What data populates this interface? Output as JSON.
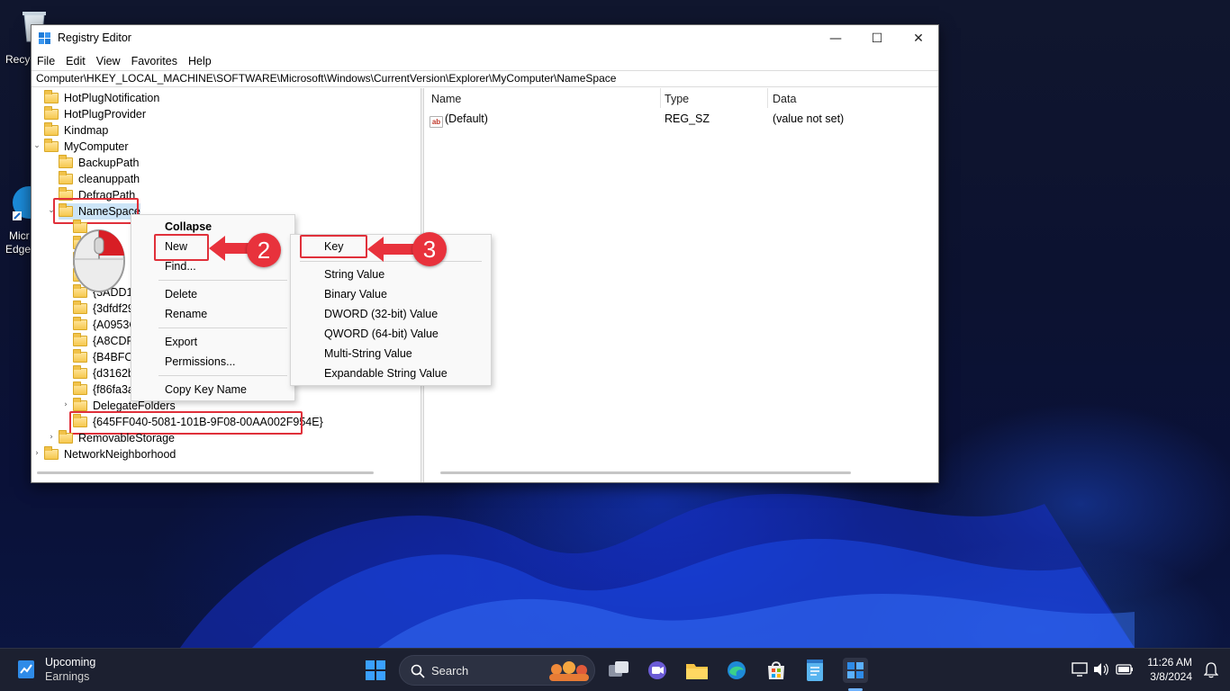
{
  "desktop": {
    "icons": [
      {
        "label": "Recyc"
      },
      {
        "label": "Micr"
      },
      {
        "label": "Edge"
      }
    ]
  },
  "window": {
    "title": "Registry Editor",
    "controls": {
      "minimize": "—",
      "maximize": "☐",
      "close": "✕"
    },
    "menu": [
      "File",
      "Edit",
      "View",
      "Favorites",
      "Help"
    ],
    "address": "Computer\\HKEY_LOCAL_MACHINE\\SOFTWARE\\Microsoft\\Windows\\CurrentVersion\\Explorer\\MyComputer\\NameSpace",
    "tree": {
      "hotplug_notification": "HotPlugNotification",
      "hotplug_provider": "HotPlugProvider",
      "kindmap": "Kindmap",
      "mycomputer": "MyComputer",
      "backuppath": "BackupPath",
      "cleanuppath": "cleanuppath",
      "defragpath": "DefragPath",
      "namespace": "NameSpace",
      "children": [
        "{3ADD16",
        "{3dfdf29",
        "{A0953C",
        "{A8CDFF",
        "{B4BFCC",
        "{d3162b",
        "{f86fa3a"
      ],
      "delegate_folders": "DelegateFolders",
      "new_key": "{645FF040-5081-101B-9F08-00AA002F954E}",
      "removable_storage": "RemovableStorage",
      "network_neighborhood": "NetworkNeighborhood"
    },
    "list": {
      "columns": {
        "name": "Name",
        "type": "Type",
        "data": "Data"
      },
      "rows": [
        {
          "name": "(Default)",
          "type": "REG_SZ",
          "data": "(value not set)",
          "icon": "ab"
        }
      ]
    }
  },
  "context_menu": {
    "collapse": "Collapse",
    "new": "New",
    "find": "Find...",
    "delete": "Delete",
    "rename": "Rename",
    "export": "Export",
    "permissions": "Permissions...",
    "copy_key_name": "Copy Key Name"
  },
  "submenu": {
    "key": "Key",
    "string_value": "String Value",
    "binary_value": "Binary Value",
    "dword_value": "DWORD (32-bit) Value",
    "qword_value": "QWORD (64-bit) Value",
    "multi_string_value": "Multi-String Value",
    "expandable_string_value": "Expandable String Value"
  },
  "annotations": {
    "step2": "2",
    "step3": "3",
    "accent": "#e8323c"
  },
  "taskbar": {
    "widget_title": "Upcoming",
    "widget_subtitle": "Earnings",
    "search_placeholder": "Search",
    "time": "11:26 AM",
    "date": "3/8/2024",
    "pinned": [
      "start-icon",
      "search-icon",
      "task-view-icon",
      "teams-icon",
      "file-explorer-icon",
      "edge-icon",
      "store-icon",
      "notepad-icon",
      "regedit-icon"
    ]
  }
}
